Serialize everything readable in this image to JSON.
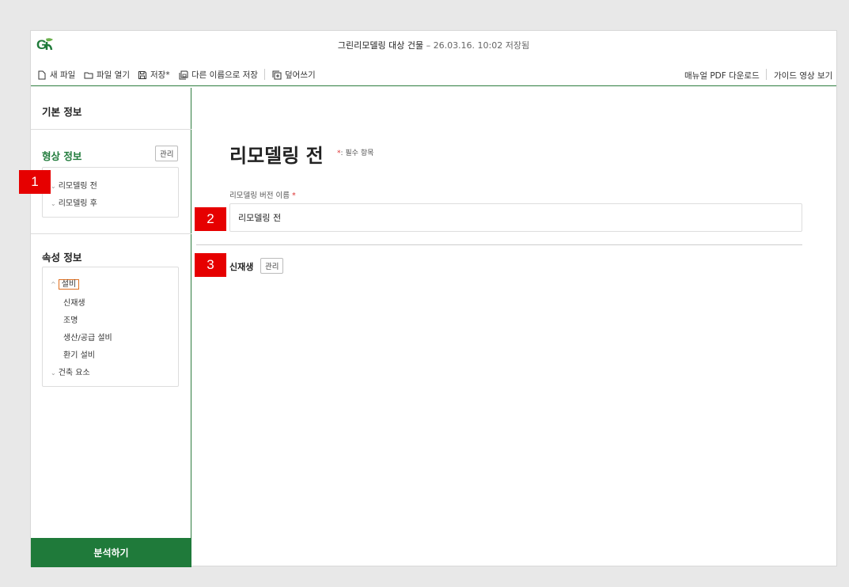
{
  "window": {
    "title": "그린리모델링 대상 건물",
    "save_stamp": " – 26.03.16. 10:02 저장됨"
  },
  "toolbar": {
    "new_file": "새 파일",
    "open_file": "파일 열기",
    "save": "저장*",
    "save_as": "다른 이름으로 저장",
    "overwrite": "덮어쓰기",
    "manual_pdf": "매뉴얼 PDF 다운로드",
    "guide_video": "가이드 영상 보기"
  },
  "sidebar": {
    "basic_info": "기본 정보",
    "shape_info": {
      "title": "형상 정보",
      "manage_label": "관리",
      "items": [
        "리모델링 전",
        "리모델링 후"
      ]
    },
    "attr_info": {
      "title": "속성 정보",
      "groups": [
        {
          "label": "설비",
          "expanded": true,
          "children": [
            "신재생",
            "조명",
            "생산/공급 설비",
            "환기 설비"
          ]
        },
        {
          "label": "건축 요소",
          "expanded": false,
          "children": []
        }
      ]
    },
    "analyze_button": "분석하기"
  },
  "main": {
    "page_title": "리모델링 전",
    "required_note": ": 필수 항목",
    "required_star": "*",
    "field_label": "리모델링 버전 이름",
    "field_value": "리모델링 전",
    "sub_section": "신재생",
    "sub_manage_label": "관리"
  },
  "annotations": [
    "1",
    "2",
    "3"
  ],
  "colors": {
    "brand_green": "#1f7a3a",
    "required_red": "#d33333",
    "badge_red": "#e60000",
    "highlight_orange": "#e07020"
  }
}
